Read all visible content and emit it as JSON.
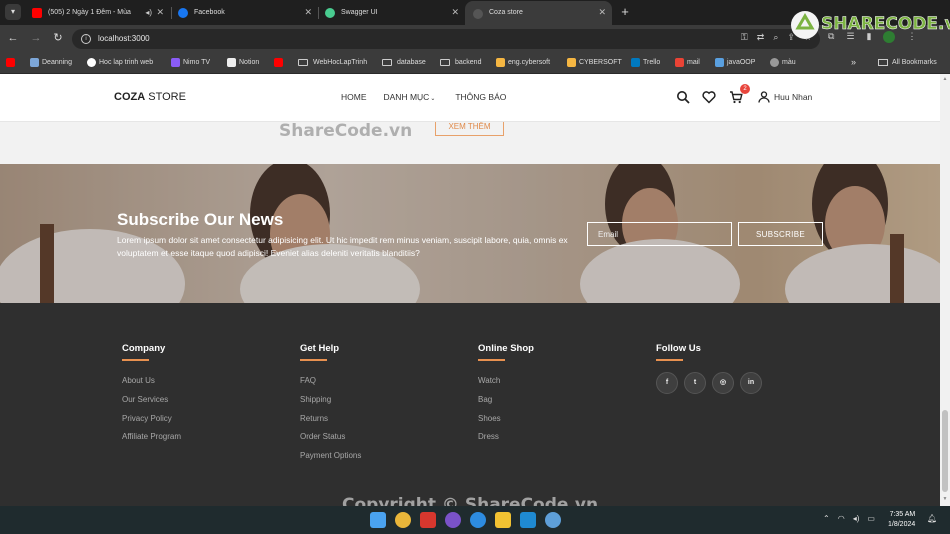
{
  "browser": {
    "tabs": [
      {
        "title": "(505) 2 Ngày 1 Đêm - Mùa",
        "favicon": "youtube-icon",
        "color": "#ff0000",
        "active": false
      },
      {
        "title": "Facebook",
        "favicon": "facebook-icon",
        "color": "#1877f2",
        "active": false
      },
      {
        "title": "Swagger UI",
        "favicon": "swagger-icon",
        "color": "#49cc90",
        "active": false
      },
      {
        "title": "Coza store",
        "favicon": "globe-icon",
        "color": "#555555",
        "active": true
      }
    ],
    "url": "localhost:3000",
    "bookmarks": [
      {
        "label": "",
        "icon": "youtube-icon"
      },
      {
        "label": "Deanning",
        "icon": "site-icon"
      },
      {
        "label": "Hoc lap trinh web",
        "icon": "site-icon"
      },
      {
        "label": "Nimo TV",
        "icon": "site-icon"
      },
      {
        "label": "Notion",
        "icon": "notion-icon"
      },
      {
        "label": "",
        "icon": "youtube-icon"
      },
      {
        "label": "WebHocLapTrinh",
        "icon": "folder-icon"
      },
      {
        "label": "database",
        "icon": "folder-icon"
      },
      {
        "label": "backend",
        "icon": "folder-icon"
      },
      {
        "label": "eng.cybersoft",
        "icon": "site-icon"
      },
      {
        "label": "CYBERSOFT",
        "icon": "site-icon"
      },
      {
        "label": "Trello",
        "icon": "trello-icon"
      },
      {
        "label": "mail",
        "icon": "gmail-icon"
      },
      {
        "label": "javaOOP",
        "icon": "site-icon"
      },
      {
        "label": "màu",
        "icon": "globe-icon"
      }
    ],
    "bookmarks_more": "»",
    "all_bookmarks": "All Bookmarks"
  },
  "site": {
    "logo_bold": "COZA",
    "logo_rest": " STORE",
    "menu": [
      "HOME",
      "DANH MỤC",
      "THÔNG BÁO"
    ],
    "cart_count": "2",
    "user_name": "Huu Nhan",
    "xem_them": "XEM THÊM"
  },
  "subscribe": {
    "title": "Subscribe Our News",
    "text": "Lorem ipsum dolor sit amet consectetur adipisicing elit. Ut hic impedit rem minus veniam, suscipit labore, quia, omnis ex voluptatem et esse itaque quod adipisci! Eveniet alias deleniti veritatis blanditiis?",
    "email_placeholder": "Email",
    "button": "SUBSCRIBE"
  },
  "footer": {
    "columns": [
      {
        "title": "Company",
        "links": [
          "About Us",
          "Our Services",
          "Privacy Policy",
          "Affiliate Program"
        ]
      },
      {
        "title": "Get Help",
        "links": [
          "FAQ",
          "Shipping",
          "Returns",
          "Order Status",
          "Payment Options"
        ]
      },
      {
        "title": "Online Shop",
        "links": [
          "Watch",
          "Bag",
          "Shoes",
          "Dress"
        ]
      },
      {
        "title": "Follow Us",
        "social": [
          "facebook-icon",
          "twitter-icon",
          "instagram-icon",
          "linkedin-icon"
        ]
      }
    ],
    "accent": "#e89150"
  },
  "watermarks": {
    "logo": "SHARECODE.vn",
    "text": "ShareCode.vn",
    "copyright": "Copyright © ShareCode.vn"
  },
  "taskbar": {
    "time": "7:35 AM",
    "date": "1/8/2024"
  }
}
